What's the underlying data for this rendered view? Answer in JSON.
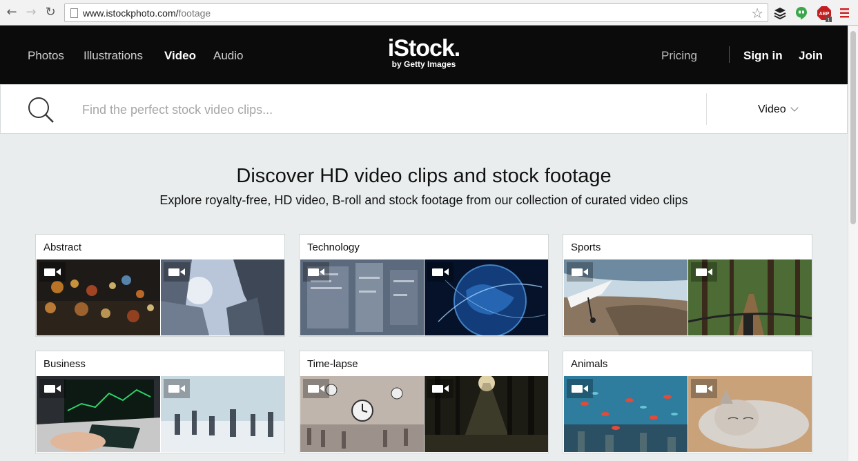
{
  "browser": {
    "url_domain": "www.istockphoto.com/",
    "url_path": "footage"
  },
  "header": {
    "nav": [
      "Photos",
      "Illustrations",
      "Video",
      "Audio"
    ],
    "active_nav": "Video",
    "logo_main": "iStock.",
    "logo_sub": "by Getty Images",
    "pricing": "Pricing",
    "signin": "Sign in",
    "join": "Join"
  },
  "search": {
    "placeholder": "Find the perfect stock video clips...",
    "type": "Video"
  },
  "hero": {
    "title": "Discover HD video clips and stock footage",
    "subtitle": "Explore royalty-free, HD video, B-roll and stock footage from our collection of curated video clips"
  },
  "categories": [
    {
      "title": "Abstract",
      "thumbs": [
        "bokeh-city-lights",
        "skyscrapers-looking-up"
      ]
    },
    {
      "title": "Technology",
      "thumbs": [
        "data-screens",
        "digital-globe"
      ]
    },
    {
      "title": "Sports",
      "thumbs": [
        "hang-glider-coast",
        "mountain-bike-forest"
      ]
    },
    {
      "title": "Business",
      "thumbs": [
        "tablet-stock-charts",
        "commuters-station"
      ]
    },
    {
      "title": "Time-lapse",
      "thumbs": [
        "station-clock-crowd",
        "forest-sunbeams"
      ]
    },
    {
      "title": "Animals",
      "thumbs": [
        "coral-reef-fish",
        "sleeping-cat"
      ]
    }
  ],
  "colors": {
    "header_bg": "#0b0b0b",
    "page_bg": "#e9eded"
  }
}
